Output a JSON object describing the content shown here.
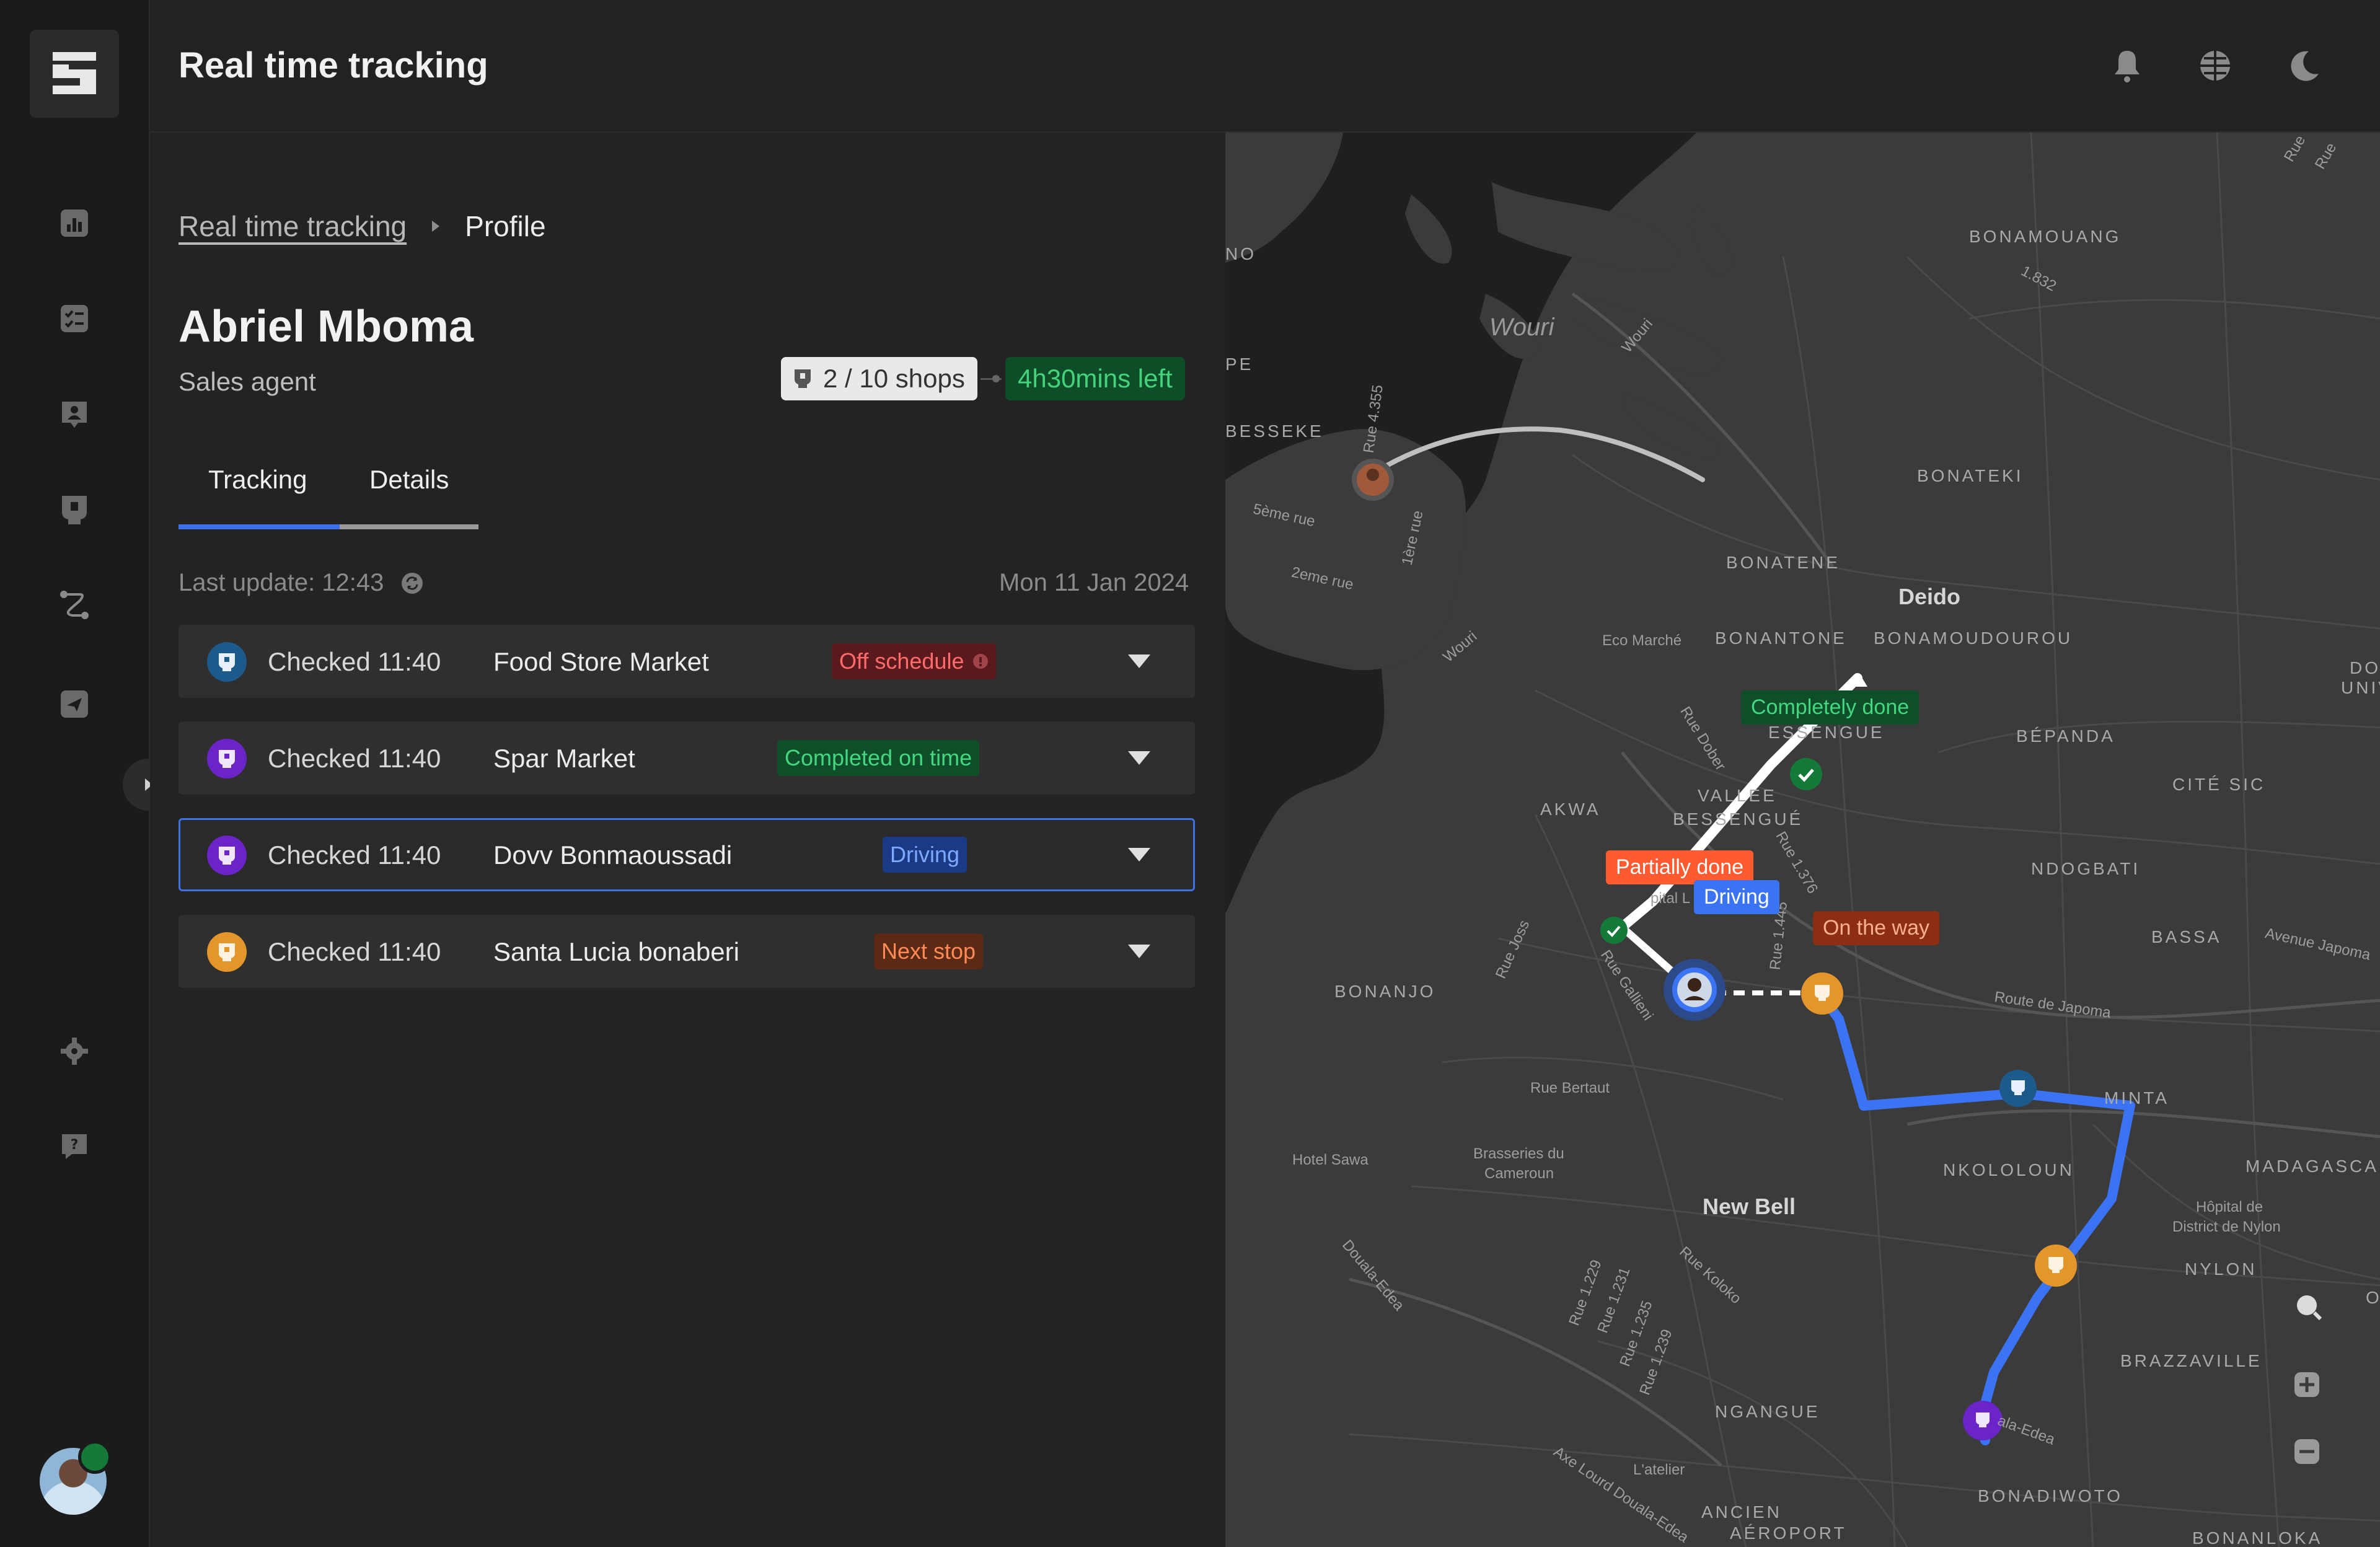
{
  "app": {
    "title": "Real time tracking"
  },
  "sidebar": {
    "items": [
      {
        "icon": "dashboard-icon"
      },
      {
        "icon": "tasks-icon"
      },
      {
        "icon": "contacts-icon"
      },
      {
        "icon": "shop-icon"
      },
      {
        "icon": "route-icon"
      },
      {
        "icon": "send-icon"
      },
      {
        "icon": "settings-icon"
      },
      {
        "icon": "help-icon"
      }
    ],
    "user": {
      "status_color": "#137a3a"
    }
  },
  "breadcrumb": {
    "parent": "Real time tracking",
    "current": "Profile"
  },
  "profile": {
    "name": "Abriel Mboma",
    "role": "Sales agent",
    "shops": "2 / 10 shops",
    "time_left": "4h30mins left"
  },
  "tabs": {
    "tracking": "Tracking",
    "details": "Details"
  },
  "tracking": {
    "last_update": "Last update: 12:43",
    "date": "Mon 11 Jan 2024",
    "stops": [
      {
        "checked": "Checked 11:40",
        "name": "Food Store Market",
        "status": "Off schedule"
      },
      {
        "checked": "Checked 11:40",
        "name": "Spar Market",
        "status": "Completed on time"
      },
      {
        "checked": "Checked 11:40",
        "name": "Dovv Bonmaoussadi",
        "status": "Driving"
      },
      {
        "checked": "Checked 11:40",
        "name": "Santa Lucia bonaberi",
        "status": "Next stop"
      }
    ]
  },
  "map": {
    "labels": {
      "bonamouang": "BONAMOUANG",
      "n1832": "1.832",
      "wouri": "Wouri",
      "wouri_small": "Wouri",
      "wouri_small2": "Wouri",
      "besseke": "BESSEKE",
      "no": "NO",
      "pe": "PE",
      "rue4355": "Rue 4.355",
      "rue5": "5ème rue",
      "rue1": "1ère rue",
      "rue2": "2eme rue",
      "bonateki": "BONATEKI",
      "bonatene": "BONATENE",
      "deido": "Deido",
      "eco": "Eco Marché",
      "bonantone": "BONANTONE",
      "bonamoudourou": "BONAMOUDOUROU",
      "do": "DO",
      "unive": "UNIVE",
      "essengue": "ESSENGUE",
      "bepanda": "BÉPANDA",
      "cite": "CITÉ SIC",
      "akwa": "AKWA",
      "vallee": "VALLEE",
      "bessengue": "BESSENGUÉ",
      "ruedober": "Rue Dober",
      "rue1376": "Rue 1.376",
      "ndogbati": "NDOGBATI",
      "rue1445": "Rue 1.445",
      "bassa": "BASSA",
      "avjapoma": "Avenue Japoma",
      "ruejoss": "Rue Joss",
      "ruegallieni": "Rue Gallieni",
      "hospital": "pital L",
      "bonanjo": "BONANJO",
      "routejapoma": "Route de Japoma",
      "minta": "MINTA",
      "ruebertaut": "Rue Bertaut",
      "hotelsawa": "Hotel Sawa",
      "brasseries1": "Brasseries du",
      "brasseries2": "Cameroun",
      "nkololoun": "NKOLOLOUN",
      "madagasca": "MADAGASCA",
      "hopital1": "Hôpital de",
      "hopital2": "District de Nylon",
      "newbell": "New Bell",
      "doualaedea": "Douala-Edea",
      "ruekoloko": "Rue Koloko",
      "nylon": "NYLON",
      "rue1229": "Rue 1.229",
      "rue1231": "Rue 1.231",
      "rue1235": "Rue 1.235",
      "rue1239": "Rue 1.239",
      "brazzaville": "BRAZZAVILLE",
      "ngangue": "NGANGUE",
      "aledea": "ala-Edea",
      "axelourd": "Axe Lourd Douala-Edea",
      "latelier": "L'atelier",
      "ancien": "ANCIEN",
      "aeroport": "AÉROPORT",
      "bonadiwoto": "BONADIWOTO",
      "bonanloka": "BONANLOKA",
      "rue_top1": "Rue",
      "rue_top2": "Rue",
      "o": "O"
    },
    "tags": {
      "completely_done": "Completely done",
      "partially_done": "Partially done",
      "driving": "Driving",
      "on_the_way": "On the way"
    }
  },
  "colors": {
    "accent": "#3b6ff0",
    "route": "#3a74f5",
    "off_schedule_bg": "#5a1a1d",
    "off_schedule_fg": "#ff6b6b",
    "completed_bg": "#0e4f2a",
    "completed_fg": "#45d680",
    "driving_bg": "#1a3a85",
    "driving_fg": "#7fa8ff",
    "next_bg": "#5b2a14",
    "next_fg": "#ff8a55",
    "partial_bg": "#ff5a30",
    "ontheway_bg": "#8b2e12"
  }
}
